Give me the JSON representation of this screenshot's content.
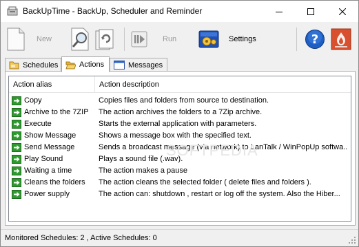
{
  "window": {
    "title": "BackUpTime - BackUp, Scheduler and Reminder"
  },
  "toolbar": {
    "new_label": "New",
    "run_label": "Run",
    "settings_label": "Settings"
  },
  "tabs": [
    {
      "label": "Schedules",
      "icon": "folder-icon",
      "active": false
    },
    {
      "label": "Actions",
      "icon": "folder-open-icon",
      "active": true
    },
    {
      "label": "Messages",
      "icon": "window-icon",
      "active": false
    }
  ],
  "table": {
    "columns": [
      "Action alias",
      "Action description"
    ],
    "rows": [
      {
        "alias": "Copy",
        "description": "Copies files and folders from source to destination."
      },
      {
        "alias": "Archive to the 7ZIP",
        "description": "The action archives the folders to a 7Zip archive."
      },
      {
        "alias": "Execute",
        "description": "Starts the external application with parameters."
      },
      {
        "alias": "Show Message",
        "description": "Shows a message box with the specified text."
      },
      {
        "alias": "Send Message",
        "description": "Sends a broadcast message (via network) to LanTalk / WinPopUp softwa..."
      },
      {
        "alias": "Play Sound",
        "description": "Plays a sound file (.wav)."
      },
      {
        "alias": "Waiting a time",
        "description": "The action makes a pause"
      },
      {
        "alias": "Cleans the folders",
        "description": "The action cleans the selected folder ( delete files and folders )."
      },
      {
        "alias": "Power supply",
        "description": "The action can: shutdown , restart or log off the system. Also the Hiber..."
      }
    ],
    "row_icon": "green-arrow-icon"
  },
  "watermark": "SOFTPEDIA",
  "status": {
    "text": "Monitored Schedules: 2 , Active Schedules: 0"
  },
  "colors": {
    "row_icon_green": "#2e9a2e",
    "settings_icon_blue": "#1e4fb5",
    "help_icon_blue": "#1f5fc4",
    "app_icon_red": "#d9502e",
    "disabled_text": "#9a9a9a"
  }
}
